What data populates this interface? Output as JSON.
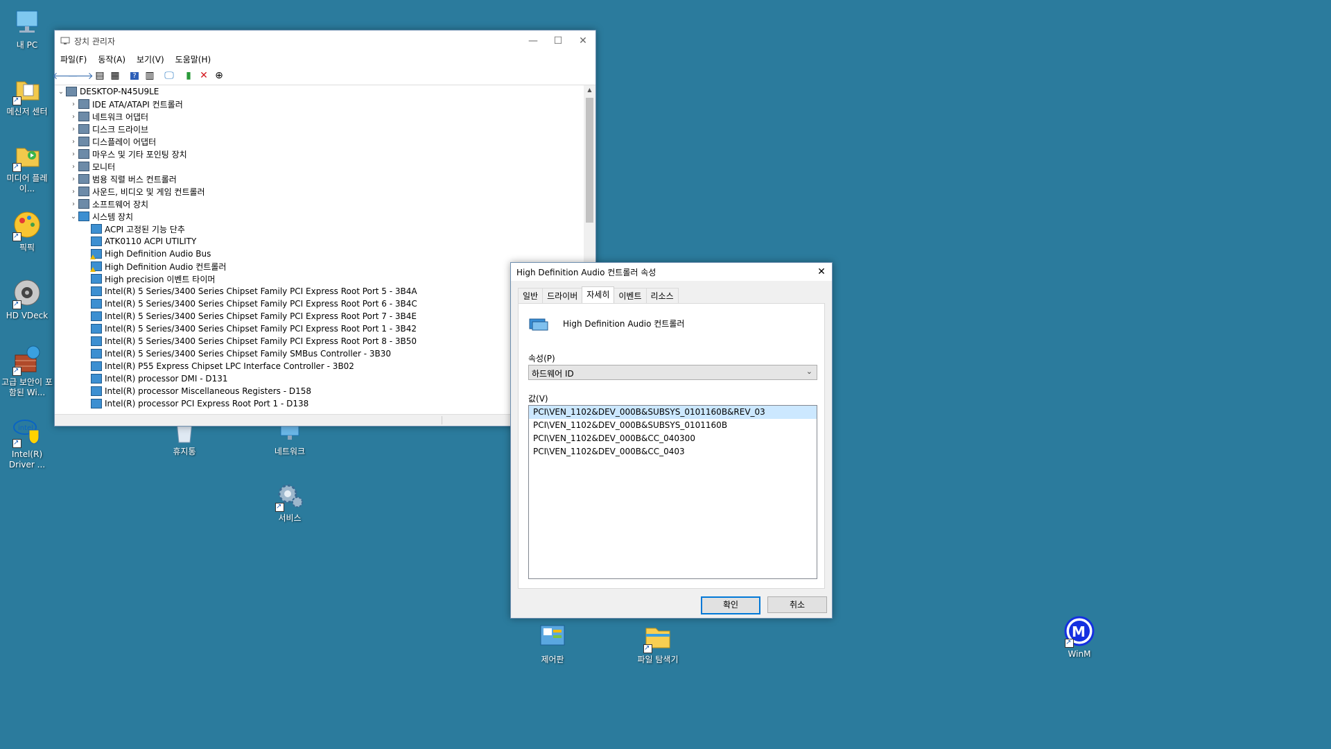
{
  "desktop": {
    "icons": [
      {
        "label": "내 PC"
      },
      {
        "label": "메신저 센터"
      },
      {
        "label": "미디어 플레이..."
      },
      {
        "label": "픽픽"
      },
      {
        "label": "HD VDeck"
      },
      {
        "label": "고급 보안이 포함된 Wi..."
      },
      {
        "label": "Intel(R) Driver ..."
      },
      {
        "label": "휴지통"
      },
      {
        "label": "네트워크"
      },
      {
        "label": "서비스"
      },
      {
        "label": "제어판"
      },
      {
        "label": "파일 탐색기"
      },
      {
        "label": "WinM"
      }
    ]
  },
  "device_manager": {
    "title": "장치 관리자",
    "menu": [
      "파일(F)",
      "동작(A)",
      "보기(V)",
      "도움말(H)"
    ],
    "toolbar_icons": [
      "back-icon",
      "forward-icon",
      "properties-pane-icon",
      "list-icon",
      "help-icon",
      "show-hidden-icon",
      "monitor-icon",
      "add-driver-icon",
      "uninstall-icon",
      "update-icon"
    ],
    "root": "DESKTOP-N45U9LE",
    "categories": [
      "IDE ATA/ATAPI 컨트롤러",
      "네트워크 어댑터",
      "디스크 드라이브",
      "디스플레이 어댑터",
      "마우스 및 기타 포인팅 장치",
      "모니터",
      "범용 직렬 버스 컨트롤러",
      "사운드, 비디오 및 게임 컨트롤러",
      "소프트웨어 장치"
    ],
    "expanded_category": "시스템 장치",
    "system_devices": [
      {
        "name": "ACPI 고정된 기능 단추",
        "warn": false
      },
      {
        "name": "ATK0110 ACPI UTILITY",
        "warn": false
      },
      {
        "name": "High Definition Audio Bus",
        "warn": true
      },
      {
        "name": "High Definition Audio 컨트롤러",
        "warn": true
      },
      {
        "name": "High precision 이벤트 타이머",
        "warn": false
      },
      {
        "name": "Intel(R) 5 Series/3400 Series Chipset Family PCI Express Root Port 5 - 3B4A",
        "warn": false
      },
      {
        "name": "Intel(R) 5 Series/3400 Series Chipset Family PCI Express Root Port 6 - 3B4C",
        "warn": false
      },
      {
        "name": "Intel(R) 5 Series/3400 Series Chipset Family PCI Express Root Port 7 - 3B4E",
        "warn": false
      },
      {
        "name": "Intel(R) 5 Series/3400 Series Chipset Family PCI Express Root Port 1 - 3B42",
        "warn": false
      },
      {
        "name": "Intel(R) 5 Series/3400 Series Chipset Family PCI Express Root Port 8 - 3B50",
        "warn": false
      },
      {
        "name": "Intel(R) 5 Series/3400 Series Chipset Family SMBus Controller - 3B30",
        "warn": false
      },
      {
        "name": "Intel(R) P55 Express Chipset LPC Interface Controller - 3B02",
        "warn": false
      },
      {
        "name": "Intel(R) processor DMI - D131",
        "warn": false
      },
      {
        "name": "Intel(R) processor Miscellaneous Registers - D158",
        "warn": false
      },
      {
        "name": "Intel(R) processor PCI Express Root Port 1 - D138",
        "warn": false
      }
    ]
  },
  "properties": {
    "title": "High Definition Audio 컨트롤러 속성",
    "tabs": [
      "일반",
      "드라이버",
      "자세히",
      "이벤트",
      "리소스"
    ],
    "active_tab": "자세히",
    "device_name": "High Definition Audio 컨트롤러",
    "property_label": "속성(P)",
    "property_selected": "하드웨어 ID",
    "value_label": "값(V)",
    "values": [
      "PCI\\VEN_1102&DEV_000B&SUBSYS_0101160B&REV_03",
      "PCI\\VEN_1102&DEV_000B&SUBSYS_0101160B",
      "PCI\\VEN_1102&DEV_000B&CC_040300",
      "PCI\\VEN_1102&DEV_000B&CC_0403"
    ],
    "ok_label": "확인",
    "cancel_label": "취소"
  }
}
